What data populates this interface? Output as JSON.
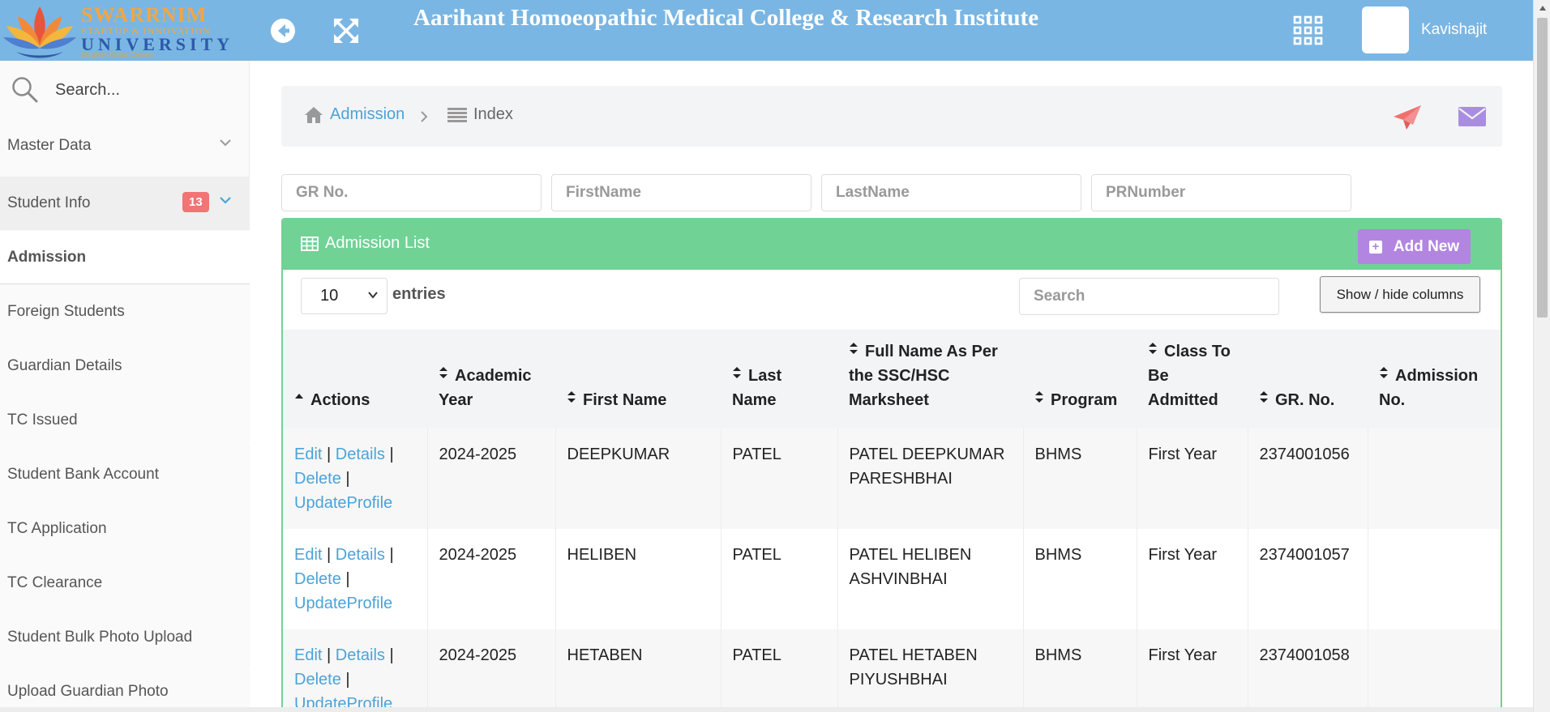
{
  "header": {
    "logo": {
      "name": "SWARRNIM",
      "tagline": "STARTUP & INNOVATION",
      "university": "UNIVERSITY",
      "motto": "Enlighten Global Careers"
    },
    "title": "Aarihant Homoeopathic Medical College & Research Institute",
    "user_name": "Kavishajit"
  },
  "sidebar": {
    "search_placeholder": "Search...",
    "groups": [
      {
        "label": "Master Data"
      },
      {
        "label": "Student Info",
        "badge": "13"
      }
    ],
    "items": [
      {
        "label": "Admission",
        "active": true
      },
      {
        "label": "Foreign Students"
      },
      {
        "label": "Guardian Details"
      },
      {
        "label": "TC Issued"
      },
      {
        "label": "Student Bank Account"
      },
      {
        "label": "TC Application"
      },
      {
        "label": "TC Clearance"
      },
      {
        "label": "Student Bulk Photo Upload"
      },
      {
        "label": "Upload Guardian Photo"
      }
    ]
  },
  "breadcrumb": {
    "home": "Admission",
    "current": "Index"
  },
  "filters": {
    "gr_no": "GR No.",
    "first_name": "FirstName",
    "last_name": "LastName",
    "pr_number": "PRNumber"
  },
  "list": {
    "title": "Admission List",
    "add_new": "Add New",
    "page_size": "10",
    "entries_label": "entries",
    "search_placeholder": "Search",
    "colvis_label": "Show / hide columns",
    "columns": [
      "Actions",
      "Academic Year",
      "First Name",
      "Last Name",
      "Full Name As Per the SSC/HSC Marksheet",
      "Program",
      "Class To Be Admitted",
      "GR. No.",
      "Admission No."
    ],
    "actions": {
      "edit": "Edit",
      "details": "Details",
      "delete": "Delete",
      "update": "UpdateProfile",
      "sep": "|"
    },
    "rows": [
      {
        "year": "2024-2025",
        "first": "DEEPKUMAR",
        "last": "PATEL",
        "full": "PATEL DEEPKUMAR PARESHBHAI",
        "program": "BHMS",
        "class": "First Year",
        "gr": "2374001056",
        "adm": ""
      },
      {
        "year": "2024-2025",
        "first": "HELIBEN",
        "last": "PATEL",
        "full": "PATEL HELIBEN ASHVINBHAI",
        "program": "BHMS",
        "class": "First Year",
        "gr": "2374001057",
        "adm": ""
      },
      {
        "year": "2024-2025",
        "first": "HETABEN",
        "last": "PATEL",
        "full": "PATEL HETABEN PIYUSHBHAI",
        "program": "BHMS",
        "class": "First Year",
        "gr": "2374001058",
        "adm": ""
      }
    ]
  },
  "colors": {
    "header_bg": "#7ab6e3",
    "panel_green": "#71d296",
    "add_button": "#b185e0",
    "link": "#4ba3d9",
    "badge": "#f27474",
    "send_icon": "#f07070",
    "mail_icon": "#a98ee0"
  },
  "icons": [
    "back-circle-icon",
    "expand-icon",
    "apps-grid-icon",
    "search-icon",
    "chevron-down-icon",
    "home-icon",
    "list-icon",
    "send-icon",
    "mail-icon",
    "table-icon",
    "plus-icon",
    "sort-icon"
  ]
}
